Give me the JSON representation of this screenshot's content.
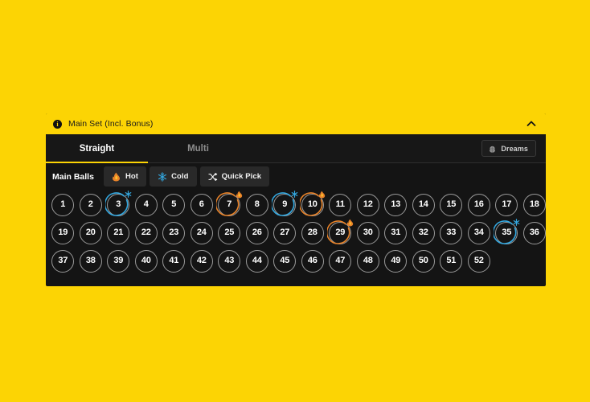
{
  "theme": {
    "page_background": "#FCD404",
    "accent": "#FCD404",
    "panel_background": "#141414",
    "hot_color": "#E8832A",
    "cold_color": "#34A8E0",
    "ball_border": "#9A9A9A"
  },
  "panel": {
    "info_icon": "info-icon",
    "info_icon_glyph": "i",
    "title": "Main Set (Incl. Bonus)",
    "collapse_icon": "chevron-up-icon"
  },
  "tabs": [
    {
      "label": "Straight",
      "active": true
    },
    {
      "label": "Multi",
      "active": false
    }
  ],
  "dreams_button": {
    "label": "Dreams",
    "icon": "dreams-brain-icon"
  },
  "toolbar": {
    "label": "Main Balls",
    "chips": [
      {
        "label": "Hot",
        "icon": "flame-icon",
        "color": "#E8832A"
      },
      {
        "label": "Cold",
        "icon": "snowflake-icon",
        "color": "#34A8E0"
      },
      {
        "label": "Quick Pick",
        "icon": "shuffle-icon",
        "color": "#FFFFFF"
      }
    ]
  },
  "ball_grid": {
    "total": 52,
    "per_row": 18,
    "rows": [
      [
        {
          "n": 1
        },
        {
          "n": 2
        },
        {
          "n": 3,
          "marker": "cold"
        },
        {
          "n": 4
        },
        {
          "n": 5
        },
        {
          "n": 6
        },
        {
          "n": 7,
          "marker": "hot"
        },
        {
          "n": 8
        },
        {
          "n": 9,
          "marker": "cold"
        },
        {
          "n": 10,
          "marker": "hot"
        },
        {
          "n": 11
        },
        {
          "n": 12
        },
        {
          "n": 13
        },
        {
          "n": 14
        },
        {
          "n": 15
        },
        {
          "n": 16
        },
        {
          "n": 17
        },
        {
          "n": 18
        }
      ],
      [
        {
          "n": 19
        },
        {
          "n": 20
        },
        {
          "n": 21
        },
        {
          "n": 22
        },
        {
          "n": 23
        },
        {
          "n": 24
        },
        {
          "n": 25
        },
        {
          "n": 26
        },
        {
          "n": 27
        },
        {
          "n": 28
        },
        {
          "n": 29,
          "marker": "hot"
        },
        {
          "n": 30
        },
        {
          "n": 31
        },
        {
          "n": 32
        },
        {
          "n": 33
        },
        {
          "n": 34
        },
        {
          "n": 35,
          "marker": "cold"
        },
        {
          "n": 36
        }
      ],
      [
        {
          "n": 37
        },
        {
          "n": 38
        },
        {
          "n": 39
        },
        {
          "n": 40
        },
        {
          "n": 41
        },
        {
          "n": 42
        },
        {
          "n": 43
        },
        {
          "n": 44
        },
        {
          "n": 45
        },
        {
          "n": 46
        },
        {
          "n": 47
        },
        {
          "n": 48
        },
        {
          "n": 49
        },
        {
          "n": 50
        },
        {
          "n": 51
        },
        {
          "n": 52
        }
      ]
    ]
  }
}
